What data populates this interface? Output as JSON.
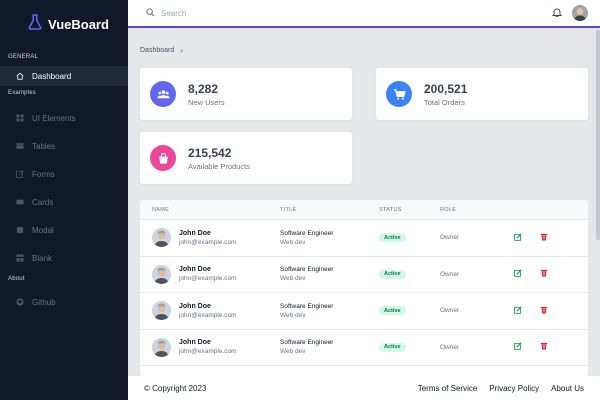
{
  "brand": {
    "name": "VueBoard",
    "icon": "flask-icon",
    "accent": "#4f46e5"
  },
  "sidebar": {
    "section_general": "GENERAL",
    "section_examples": "Examples",
    "section_about": "About",
    "dashboard": {
      "label": "Dashboard",
      "icon": "home-icon"
    },
    "examples": [
      {
        "label": "UI Elements",
        "icon": "grid-icon"
      },
      {
        "label": "Tables",
        "icon": "table-icon"
      },
      {
        "label": "Forms",
        "icon": "edit-icon"
      },
      {
        "label": "Cards",
        "icon": "card-icon"
      },
      {
        "label": "Modal",
        "icon": "stack-icon"
      },
      {
        "label": "Blank",
        "icon": "layout-icon"
      }
    ],
    "about": [
      {
        "label": "Github",
        "icon": "github-icon"
      }
    ]
  },
  "header": {
    "search_placeholder": "Search"
  },
  "breadcrumb": {
    "current": "Dashboard"
  },
  "stats": [
    {
      "value": "8,282",
      "label": "New Users",
      "color": "#6366f1",
      "icon": "users-icon"
    },
    {
      "value": "200,521",
      "label": "Total Orders",
      "color": "#3b82f6",
      "icon": "cart-icon"
    },
    {
      "value": "215,542",
      "label": "Available Products",
      "color": "#ec4899",
      "icon": "bag-icon"
    }
  ],
  "table": {
    "columns": [
      "Name",
      "Title",
      "Status",
      "Role"
    ],
    "rows": [
      {
        "name": "John Doe",
        "email": "john@example.com",
        "title": "Software Engineer",
        "dept": "Web dev",
        "status": "Active",
        "role": "Owner"
      },
      {
        "name": "John Doe",
        "email": "john@example.com",
        "title": "Software Engineer",
        "dept": "Web dev",
        "status": "Active",
        "role": "Owner"
      },
      {
        "name": "John Doe",
        "email": "john@example.com",
        "title": "Software Engineer",
        "dept": "Web dev",
        "status": "Active",
        "role": "Owner"
      },
      {
        "name": "John Doe",
        "email": "john@example.com",
        "title": "Software Engineer",
        "dept": "Web dev",
        "status": "Active",
        "role": "Owner"
      }
    ]
  },
  "footer": {
    "copyright": "© Copyright 2023",
    "links": [
      "Terms of Service",
      "Privacy Policy",
      "About Us"
    ]
  }
}
